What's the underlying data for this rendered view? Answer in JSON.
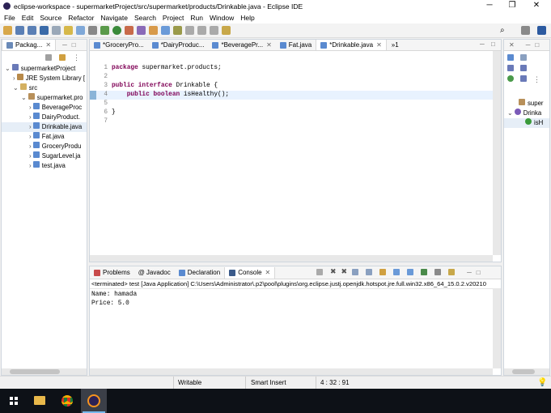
{
  "window": {
    "title": "eclipse-workspace - supermarketProject/src/supermarket/products/Drinkable.java - Eclipse IDE",
    "minimize": "─",
    "maximize": "❐",
    "close": "✕"
  },
  "menu": [
    "File",
    "Edit",
    "Source",
    "Refactor",
    "Navigate",
    "Search",
    "Project",
    "Run",
    "Window",
    "Help"
  ],
  "package_explorer": {
    "tab_label": "Packag...",
    "items": [
      {
        "label": "supermarketProject",
        "depth": 0,
        "icon": "project-icon"
      },
      {
        "label": "JRE System Library [",
        "depth": 1,
        "icon": "library-icon"
      },
      {
        "label": "src",
        "depth": 1,
        "icon": "folder-icon"
      },
      {
        "label": "supermarket.pro",
        "depth": 2,
        "icon": "package-icon"
      },
      {
        "label": "BeverageProc",
        "depth": 3,
        "icon": "java-file-icon"
      },
      {
        "label": "DairyProduct.",
        "depth": 3,
        "icon": "java-file-icon"
      },
      {
        "label": "Drinkable.java",
        "depth": 3,
        "icon": "java-file-icon"
      },
      {
        "label": "Fat.java",
        "depth": 3,
        "icon": "java-file-icon"
      },
      {
        "label": "GroceryProdu",
        "depth": 3,
        "icon": "java-file-icon"
      },
      {
        "label": "SugarLevel.ja",
        "depth": 3,
        "icon": "java-file-icon"
      },
      {
        "label": "test.java",
        "depth": 3,
        "icon": "java-file-icon"
      }
    ]
  },
  "editor": {
    "tabs": [
      {
        "label": "*GroceryPro..."
      },
      {
        "label": "*DairyProduc..."
      },
      {
        "label": "*BeveragePr..."
      },
      {
        "label": "Fat.java"
      },
      {
        "label": "*Drinkable.java"
      }
    ],
    "overflow": "»1",
    "lines": [
      {
        "n": "1",
        "text": "package supermarket.products;"
      },
      {
        "n": "2",
        "text": ""
      },
      {
        "n": "3",
        "text": "public interface Drinkable {"
      },
      {
        "n": "4",
        "text": "    public boolean isHealthy();"
      },
      {
        "n": "5",
        "text": ""
      },
      {
        "n": "6",
        "text": "}"
      },
      {
        "n": "7",
        "text": ""
      }
    ]
  },
  "outline": {
    "items": [
      "super",
      "Drinka",
      "isH"
    ]
  },
  "console": {
    "tabs": [
      "Problems",
      "Javadoc",
      "Declaration",
      "Console"
    ],
    "header": "<terminated> test [Java Application] C:\\Users\\Administrator\\.p2\\pool\\plugins\\org.eclipse.justj.openjdk.hotspot.jre.full.win32.x86_64_15.0.2.v20210",
    "output": [
      "Name: hamada",
      "Price: 5.0"
    ]
  },
  "status": {
    "writable": "Writable",
    "insert_mode": "Smart Insert",
    "position": "4 : 32 : 91"
  },
  "colors": {
    "accent": "#1c5fa8",
    "keyword": "#7f0055"
  }
}
